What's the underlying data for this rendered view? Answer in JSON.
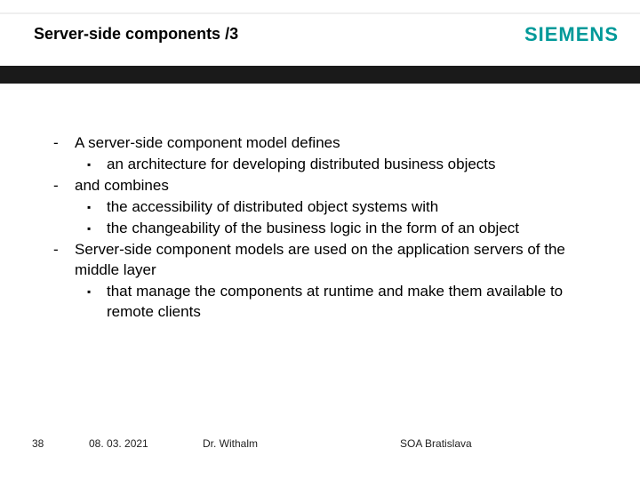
{
  "header": {
    "title": "Server-side components /3",
    "brand": "SIEMENS"
  },
  "bullets": [
    {
      "text": "A server-side component model defines",
      "subs": [
        "an architecture for developing distributed business objects"
      ]
    },
    {
      "text": "and combines",
      "subs": [
        "the accessibility of distributed object systems with",
        "the changeability of the business logic in the form of an object"
      ]
    },
    {
      "text": "Server-side component models are used on the application servers of the  middle layer",
      "subs": [
        "that manage the components at runtime and make them available to remote clients"
      ]
    }
  ],
  "footer": {
    "page": "38",
    "date": "08. 03. 2021",
    "author": "Dr. Withalm",
    "course": "SOA Bratislava"
  }
}
